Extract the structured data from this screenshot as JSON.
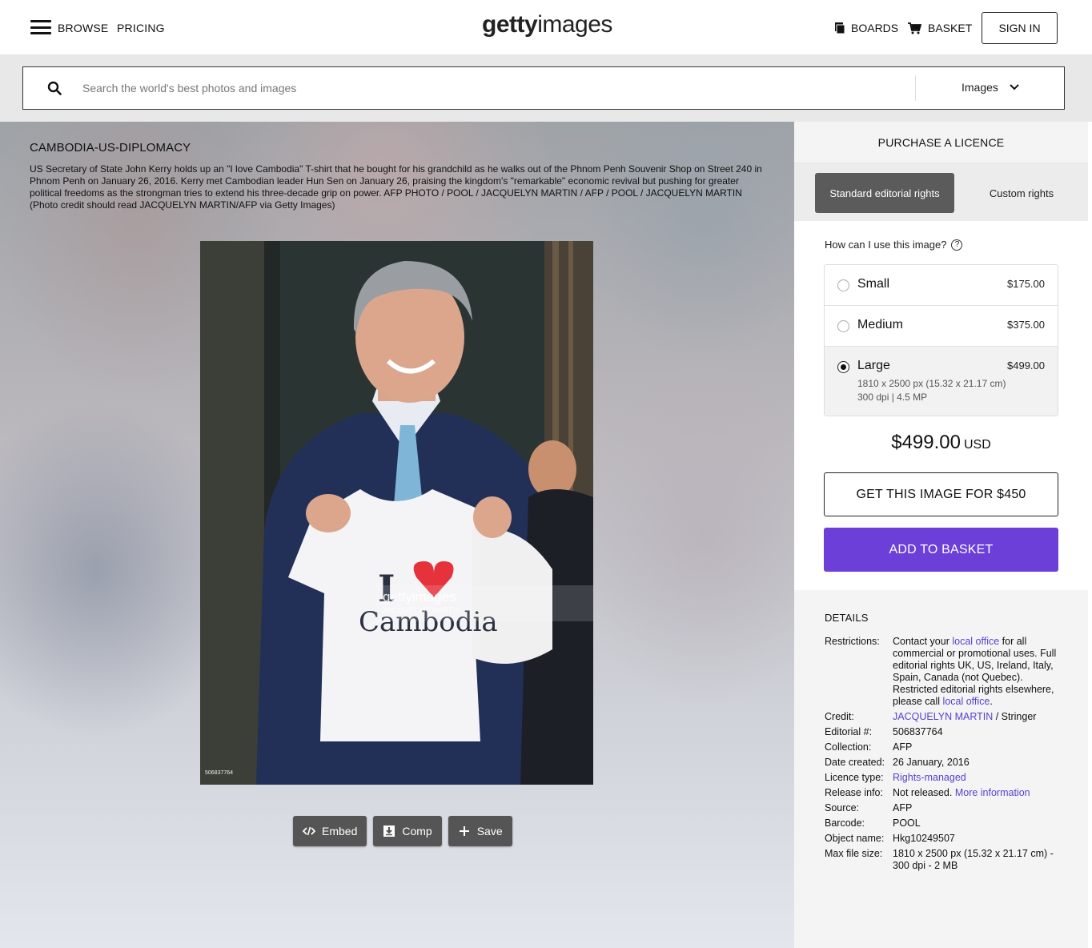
{
  "header": {
    "browse": "BROWSE",
    "pricing": "PRICING",
    "logo_bold": "getty",
    "logo_thin": "images",
    "boards": "BOARDS",
    "basket": "BASKET",
    "sign_in": "SIGN IN"
  },
  "search": {
    "placeholder": "Search the world's best photos and images",
    "type": "Images"
  },
  "image": {
    "title": "CAMBODIA-US-DIPLOMACY",
    "caption": "US Secretary of State John Kerry holds up an \"I love Cambodia\" T-shirt that he bought for his grandchild as he walks out of the Phnom Penh Souvenir Shop on Street 240 in Phnom Penh on January 26, 2016. Kerry met Cambodian leader Hun Sen on January 26, praising the kingdom's \"remarkable\" economic revival but pushing for greater political freedoms as the strongman tries to extend his three-decade grip on power. AFP PHOTO / POOL / JACQUELYN MARTIN / AFP / POOL / JACQUELYN MARTIN (Photo credit should read JACQUELYN MARTIN/AFP via Getty Images)",
    "watermark": "gettyimages",
    "watermark_credit": "JACQUELYN MARTIN",
    "photo_id": "506837764",
    "shirt_text": "Cambodia"
  },
  "actions": {
    "embed": "Embed",
    "comp": "Comp",
    "save": "Save"
  },
  "purchase": {
    "heading": "PURCHASE A LICENCE",
    "rights_standard": "Standard editorial rights",
    "rights_custom": "Custom rights",
    "use_question": "How can I use this image?",
    "sizes": [
      {
        "name": "Small",
        "price": "$175.00"
      },
      {
        "name": "Medium",
        "price": "$375.00"
      },
      {
        "name": "Large",
        "price": "$499.00",
        "detail1": "1810 x 2500 px (15.32 x 21.17 cm)",
        "detail2": "300 dpi | 4.5 MP"
      }
    ],
    "selected_size": "Large",
    "total": "$499.00",
    "currency": "USD",
    "get_button": "GET THIS IMAGE FOR $450",
    "add_button": "ADD TO BASKET",
    "accent_color": "#6b3fd8"
  },
  "details": {
    "heading": "DETAILS",
    "restrictions_label": "Restrictions:",
    "restrictions_pre": "Contact your ",
    "restrictions_link1": "local office",
    "restrictions_mid": " for all commercial or promotional uses. Full editorial rights UK, US, Ireland, Italy, Spain, Canada (not Quebec). Restricted editorial rights elsewhere, please call ",
    "restrictions_link2": "local office",
    "restrictions_end": ".",
    "credit_label": "Credit:",
    "credit_link": "JACQUELYN MARTIN",
    "credit_rest": " / Stringer",
    "editorial_label": "Editorial #:",
    "editorial_value": "506837764",
    "collection_label": "Collection:",
    "collection_value": "AFP",
    "date_label": "Date created:",
    "date_value": "26 January, 2016",
    "licence_label": "Licence type:",
    "licence_value": "Rights-managed",
    "release_label": "Release info:",
    "release_value": "Not released. ",
    "release_link": "More information",
    "source_label": "Source:",
    "source_value": "AFP",
    "barcode_label": "Barcode:",
    "barcode_value": "POOL",
    "object_label": "Object name:",
    "object_value": "Hkg10249507",
    "maxfile_label": "Max file size:",
    "maxfile_value": "1810 x 2500 px (15.32 x 21.17 cm) - 300 dpi - 2 MB"
  }
}
